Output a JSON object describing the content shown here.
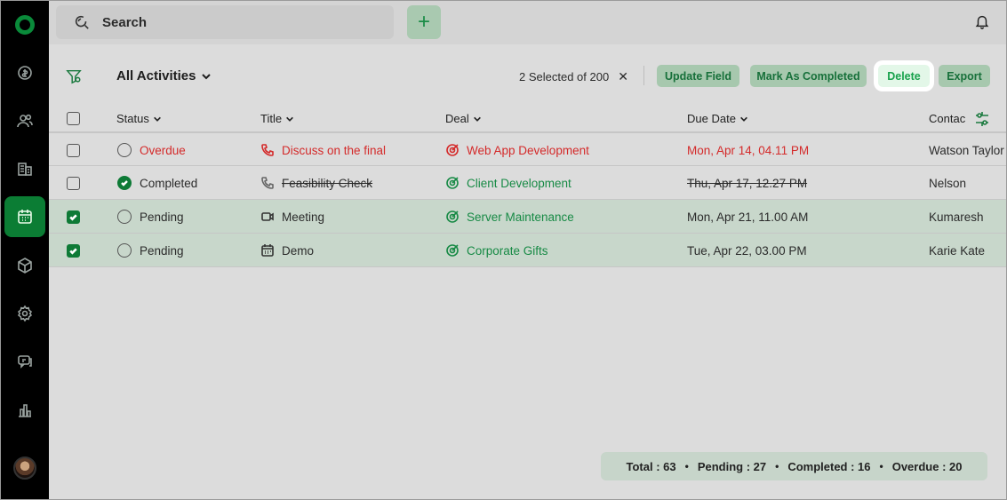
{
  "topbar": {
    "search_placeholder": "Search",
    "add_label": "+"
  },
  "sidebar": {
    "items": [
      {
        "name": "deals-icon"
      },
      {
        "name": "contacts-icon"
      },
      {
        "name": "companies-icon"
      },
      {
        "name": "activities-icon",
        "active": true
      },
      {
        "name": "products-icon"
      },
      {
        "name": "settings-icon"
      },
      {
        "name": "chat-icon"
      },
      {
        "name": "reports-icon"
      }
    ]
  },
  "toolbar": {
    "view_title": "All Activities",
    "selected_text": "2 Selected of 200",
    "clear_label": "✕",
    "buttons": {
      "update_field": "Update Field",
      "mark_completed": "Mark As Completed",
      "delete": "Delete",
      "export": "Export"
    }
  },
  "table": {
    "headers": {
      "status": "Status",
      "title": "Title",
      "deal": "Deal",
      "due_date": "Due Date",
      "contact": "Contac"
    },
    "rows": [
      {
        "checked": false,
        "status": "Overdue",
        "title": "Discuss on the final",
        "title_icon": "phone-icon",
        "deal": "Web App Development",
        "due": "Mon, Apr 14, 04.11 PM",
        "contact": "Watson Taylor"
      },
      {
        "checked": false,
        "status": "Completed",
        "title": "Feasibility Check",
        "title_icon": "phone-icon",
        "deal": "Client Development",
        "due": "Thu, Apr 17, 12.27 PM",
        "contact": "Nelson"
      },
      {
        "checked": true,
        "status": "Pending",
        "title": "Meeting",
        "title_icon": "video-icon",
        "deal": "Server Maintenance",
        "due": "Mon, Apr 21, 11.00 AM",
        "contact": "Kumaresh"
      },
      {
        "checked": true,
        "status": "Pending",
        "title": "Demo",
        "title_icon": "calendar-icon",
        "deal": "Corporate Gifts",
        "due": "Tue, Apr 22, 03.00 PM",
        "contact": "Karie Kate"
      }
    ]
  },
  "summary": {
    "total": "Total : 63",
    "pending": "Pending : 27",
    "completed": "Completed : 16",
    "overdue": "Overdue : 20",
    "separator": "•"
  },
  "colors": {
    "accent": "#0e7a36",
    "danger": "#d42a2a",
    "sidebar": "#000000"
  }
}
